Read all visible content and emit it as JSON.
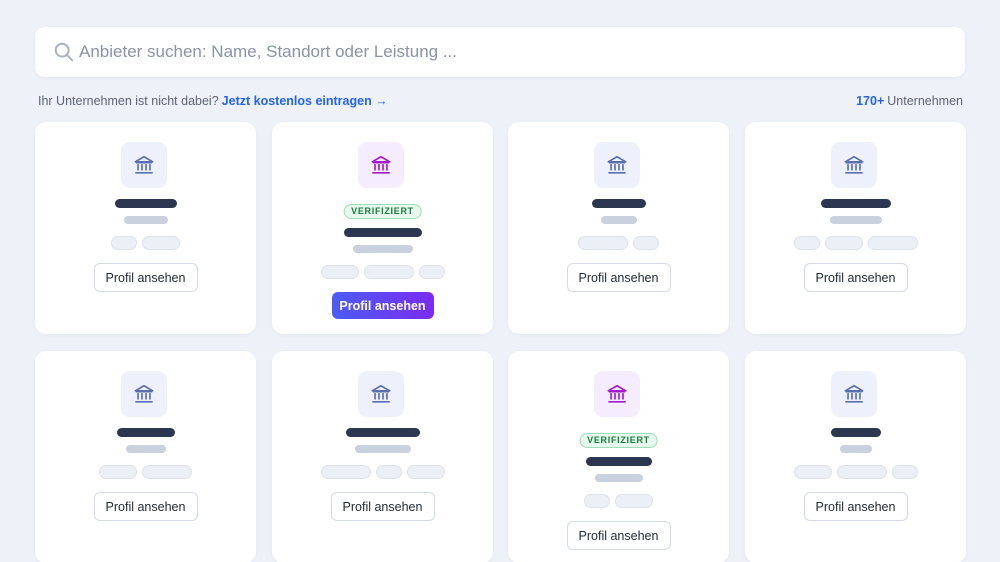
{
  "search": {
    "placeholder": "Anbieter suchen: Name, Standort oder Leistung ...",
    "value": ""
  },
  "info": {
    "prompt": "Ihr Unternehmen ist nicht dabei?",
    "cta_link": "Jetzt kostenlos eintragen →",
    "count": "170+",
    "count_suffix": "Unternehmen"
  },
  "colors": {
    "accent": "#2563eb",
    "background": "#eef1f8",
    "verified_green": "#15803d",
    "primary_gradient_start": "#4b5cf5",
    "primary_gradient_end": "#7a2cf0",
    "logo_standard": "#5b6fb0",
    "logo_premium": "#a21cc9"
  },
  "cards": [
    {
      "verified": false,
      "premium": false,
      "logo_icon": "bank-icon",
      "badge": "",
      "button_label": "Profil ansehen",
      "button_style": "outline"
    },
    {
      "verified": true,
      "premium": true,
      "logo_icon": "bank-icon",
      "badge": "VERIFIZIERT",
      "button_label": "Profil ansehen",
      "button_style": "primary"
    },
    {
      "verified": false,
      "premium": false,
      "logo_icon": "bank-icon",
      "badge": "",
      "button_label": "Profil ansehen",
      "button_style": "outline"
    },
    {
      "verified": false,
      "premium": false,
      "logo_icon": "bank-icon",
      "badge": "",
      "button_label": "Profil ansehen",
      "button_style": "outline"
    },
    {
      "verified": false,
      "premium": false,
      "logo_icon": "bank-icon",
      "badge": "",
      "button_label": "Profil ansehen",
      "button_style": "outline"
    },
    {
      "verified": false,
      "premium": false,
      "logo_icon": "bank-icon",
      "badge": "",
      "button_label": "Profil ansehen",
      "button_style": "outline"
    },
    {
      "verified": true,
      "premium": true,
      "logo_icon": "bank-icon",
      "badge": "VERIFIZIERT",
      "button_label": "Profil ansehen",
      "button_style": "outline"
    },
    {
      "verified": false,
      "premium": false,
      "logo_icon": "bank-icon",
      "badge": "",
      "button_label": "Profil ansehen",
      "button_style": "outline"
    }
  ]
}
